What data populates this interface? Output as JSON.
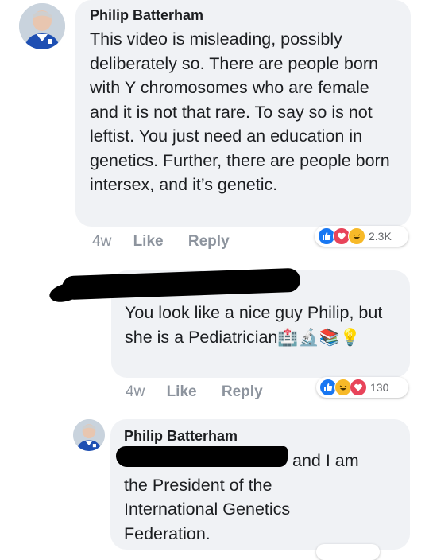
{
  "colors": {
    "bubble": "#f0f2f5",
    "like_blue": "#1877f2",
    "love_red": "#e8445a",
    "haha_yellow": "#f7b928",
    "meta_gray": "#8d949e"
  },
  "comments": [
    {
      "author": "Philip Batterham",
      "text": "This video is misleading, possibly deliberately so.  There are people born with Y chromosomes who are female and it is not that rare. To say so is not leftist.  You just need an education in genetics.  Further, there are people born intersex, and it’s genetic.",
      "time": "4w",
      "like_label": "Like",
      "reply_label": "Reply",
      "reactions": [
        "like-icon",
        "love-icon",
        "haha-icon"
      ],
      "reaction_count": "2.3K"
    },
    {
      "author": "",
      "text": "You look like a nice guy Philip, but she is a Pediatrician",
      "emoji": "🏥🔬📚💡",
      "time": "4w",
      "like_label": "Like",
      "reply_label": "Reply",
      "reactions": [
        "like-icon",
        "haha-icon",
        "love-icon"
      ],
      "reaction_count": "130"
    },
    {
      "author": "Philip Batterham",
      "text_after_redaction": "and I am",
      "text_rest": "the President of the International Genetics Federation."
    }
  ]
}
